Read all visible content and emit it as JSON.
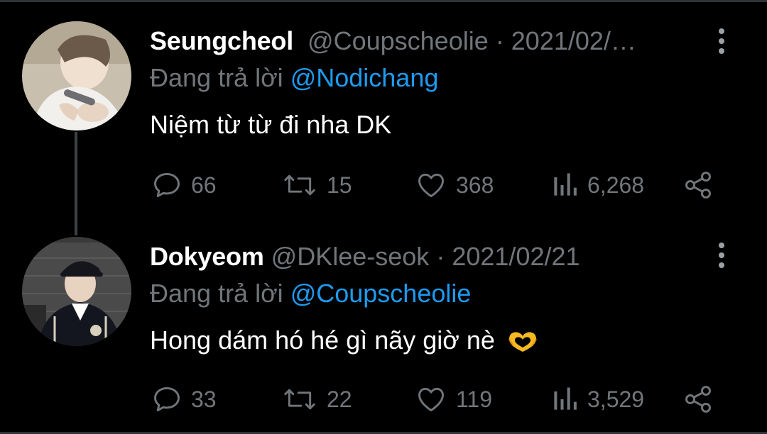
{
  "colors": {
    "background": "#000000",
    "name": "#ffffff",
    "muted": "#71767b",
    "mention": "#1d9bf0",
    "thread_line": "#3e4144"
  },
  "tweets": [
    {
      "display_name": "Seungcheol",
      "handle": "@Coupscheolie",
      "separator": "·",
      "date": "2021/02/…",
      "reply_prefix": "Đang trả lời",
      "reply_to": "@Nodichang",
      "text": "Niệm từ từ đi nha DK",
      "avatar_icon": "profile-photo",
      "actions": {
        "replies": "66",
        "retweets": "15",
        "likes": "368",
        "views": "6,268"
      }
    },
    {
      "display_name": "Dokyeom",
      "handle": "@DKlee-seok",
      "separator": "·",
      "date": "2021/02/21",
      "reply_prefix": "Đang trả lời",
      "reply_to": "@Coupscheolie",
      "text": "Hong dám hó hé gì nãy giờ nè",
      "emoji": "heart-hands-emoji",
      "avatar_icon": "profile-photo",
      "actions": {
        "replies": "33",
        "retweets": "22",
        "likes": "119",
        "views": "3,529"
      }
    }
  ]
}
